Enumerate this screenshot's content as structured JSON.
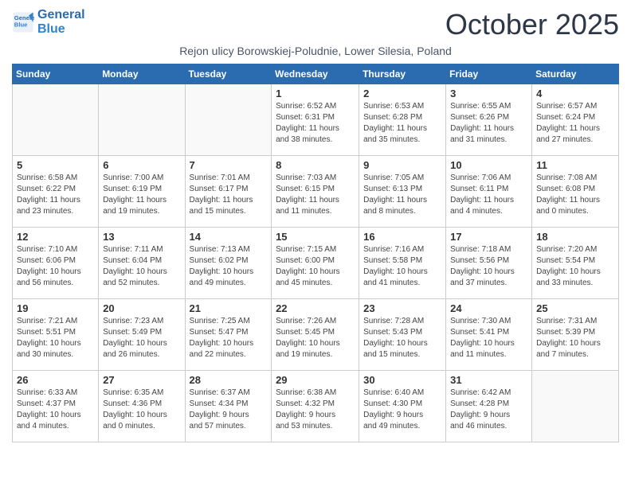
{
  "header": {
    "logo_line1": "General",
    "logo_line2": "Blue",
    "month_title": "October 2025",
    "subtitle": "Rejon ulicy Borowskiej-Poludnie, Lower Silesia, Poland"
  },
  "weekdays": [
    "Sunday",
    "Monday",
    "Tuesday",
    "Wednesday",
    "Thursday",
    "Friday",
    "Saturday"
  ],
  "weeks": [
    [
      {
        "day": "",
        "info": ""
      },
      {
        "day": "",
        "info": ""
      },
      {
        "day": "",
        "info": ""
      },
      {
        "day": "1",
        "info": "Sunrise: 6:52 AM\nSunset: 6:31 PM\nDaylight: 11 hours\nand 38 minutes."
      },
      {
        "day": "2",
        "info": "Sunrise: 6:53 AM\nSunset: 6:28 PM\nDaylight: 11 hours\nand 35 minutes."
      },
      {
        "day": "3",
        "info": "Sunrise: 6:55 AM\nSunset: 6:26 PM\nDaylight: 11 hours\nand 31 minutes."
      },
      {
        "day": "4",
        "info": "Sunrise: 6:57 AM\nSunset: 6:24 PM\nDaylight: 11 hours\nand 27 minutes."
      }
    ],
    [
      {
        "day": "5",
        "info": "Sunrise: 6:58 AM\nSunset: 6:22 PM\nDaylight: 11 hours\nand 23 minutes."
      },
      {
        "day": "6",
        "info": "Sunrise: 7:00 AM\nSunset: 6:19 PM\nDaylight: 11 hours\nand 19 minutes."
      },
      {
        "day": "7",
        "info": "Sunrise: 7:01 AM\nSunset: 6:17 PM\nDaylight: 11 hours\nand 15 minutes."
      },
      {
        "day": "8",
        "info": "Sunrise: 7:03 AM\nSunset: 6:15 PM\nDaylight: 11 hours\nand 11 minutes."
      },
      {
        "day": "9",
        "info": "Sunrise: 7:05 AM\nSunset: 6:13 PM\nDaylight: 11 hours\nand 8 minutes."
      },
      {
        "day": "10",
        "info": "Sunrise: 7:06 AM\nSunset: 6:11 PM\nDaylight: 11 hours\nand 4 minutes."
      },
      {
        "day": "11",
        "info": "Sunrise: 7:08 AM\nSunset: 6:08 PM\nDaylight: 11 hours\nand 0 minutes."
      }
    ],
    [
      {
        "day": "12",
        "info": "Sunrise: 7:10 AM\nSunset: 6:06 PM\nDaylight: 10 hours\nand 56 minutes."
      },
      {
        "day": "13",
        "info": "Sunrise: 7:11 AM\nSunset: 6:04 PM\nDaylight: 10 hours\nand 52 minutes."
      },
      {
        "day": "14",
        "info": "Sunrise: 7:13 AM\nSunset: 6:02 PM\nDaylight: 10 hours\nand 49 minutes."
      },
      {
        "day": "15",
        "info": "Sunrise: 7:15 AM\nSunset: 6:00 PM\nDaylight: 10 hours\nand 45 minutes."
      },
      {
        "day": "16",
        "info": "Sunrise: 7:16 AM\nSunset: 5:58 PM\nDaylight: 10 hours\nand 41 minutes."
      },
      {
        "day": "17",
        "info": "Sunrise: 7:18 AM\nSunset: 5:56 PM\nDaylight: 10 hours\nand 37 minutes."
      },
      {
        "day": "18",
        "info": "Sunrise: 7:20 AM\nSunset: 5:54 PM\nDaylight: 10 hours\nand 33 minutes."
      }
    ],
    [
      {
        "day": "19",
        "info": "Sunrise: 7:21 AM\nSunset: 5:51 PM\nDaylight: 10 hours\nand 30 minutes."
      },
      {
        "day": "20",
        "info": "Sunrise: 7:23 AM\nSunset: 5:49 PM\nDaylight: 10 hours\nand 26 minutes."
      },
      {
        "day": "21",
        "info": "Sunrise: 7:25 AM\nSunset: 5:47 PM\nDaylight: 10 hours\nand 22 minutes."
      },
      {
        "day": "22",
        "info": "Sunrise: 7:26 AM\nSunset: 5:45 PM\nDaylight: 10 hours\nand 19 minutes."
      },
      {
        "day": "23",
        "info": "Sunrise: 7:28 AM\nSunset: 5:43 PM\nDaylight: 10 hours\nand 15 minutes."
      },
      {
        "day": "24",
        "info": "Sunrise: 7:30 AM\nSunset: 5:41 PM\nDaylight: 10 hours\nand 11 minutes."
      },
      {
        "day": "25",
        "info": "Sunrise: 7:31 AM\nSunset: 5:39 PM\nDaylight: 10 hours\nand 7 minutes."
      }
    ],
    [
      {
        "day": "26",
        "info": "Sunrise: 6:33 AM\nSunset: 4:37 PM\nDaylight: 10 hours\nand 4 minutes."
      },
      {
        "day": "27",
        "info": "Sunrise: 6:35 AM\nSunset: 4:36 PM\nDaylight: 10 hours\nand 0 minutes."
      },
      {
        "day": "28",
        "info": "Sunrise: 6:37 AM\nSunset: 4:34 PM\nDaylight: 9 hours\nand 57 minutes."
      },
      {
        "day": "29",
        "info": "Sunrise: 6:38 AM\nSunset: 4:32 PM\nDaylight: 9 hours\nand 53 minutes."
      },
      {
        "day": "30",
        "info": "Sunrise: 6:40 AM\nSunset: 4:30 PM\nDaylight: 9 hours\nand 49 minutes."
      },
      {
        "day": "31",
        "info": "Sunrise: 6:42 AM\nSunset: 4:28 PM\nDaylight: 9 hours\nand 46 minutes."
      },
      {
        "day": "",
        "info": ""
      }
    ]
  ]
}
